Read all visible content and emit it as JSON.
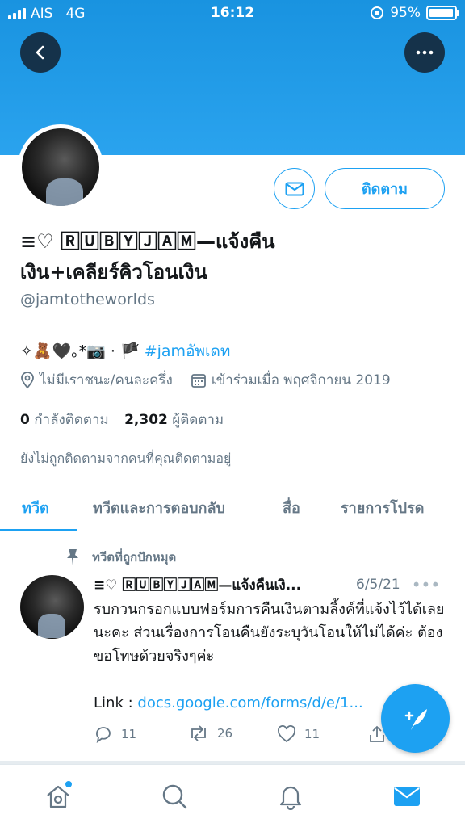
{
  "status_bar": {
    "carrier": "AIS",
    "network": "4G",
    "time": "16:12",
    "battery": "95%",
    "battery_level": 0.95
  },
  "profile": {
    "name": "≡♡ 🅁🅄🄱🅈🄹🄰🄼—แจ้งคืนเงิน+เคลียร์คิวโอนเงิน",
    "handle": "@jamtotheworlds",
    "bio_text": "✧🧸🖤｡*📷 · 🏴᷄ ",
    "bio_hashtag": "#jamอัพเดท",
    "location": "ไม่มีเราชนะ/คนละครึ่ง",
    "joined": "เข้าร่วมเมื่อ พฤศจิกายน 2019",
    "following_count": "0",
    "following_label": "กำลังติดตาม",
    "followers_count": "2,302",
    "followers_label": "ผู้ติดตาม",
    "not_followed_text": "ยังไม่ถูกติดตามจากคนที่คุณติดตามอยู่",
    "follow_label": "ติดตาม"
  },
  "tabs": [
    {
      "label": "ทวีต",
      "active": true
    },
    {
      "label": "ทวีตและการตอบกลับ",
      "active": false
    },
    {
      "label": "สื่อ",
      "active": false
    },
    {
      "label": "รายการโปรด",
      "active": false
    }
  ],
  "tweet": {
    "pinned_label": "ทวีตที่ถูกปักหมุด",
    "author": "≡♡ 🅁🅄🄱🅈🄹🄰🄼—แจ้งคืนเงิ...",
    "date": "6/5/21",
    "body": "รบกวนกรอกแบบฟอร์มการคืนเงินตามลิ้งค์ที่แจ้งไว้ได้เลยนะคะ ส่วนเรื่องการโอนคืนยังระบุวันโอนให้ไม่ได้ค่ะ ต้องขอโทษด้วยจริงๆค่ะ",
    "link_prefix": "Link :",
    "link_url": "docs.google.com/forms/d/e/1...",
    "replies": "11",
    "retweets": "26",
    "likes": "11"
  },
  "colors": {
    "accent": "#1da1f2",
    "banner": "#1e98e6",
    "muted": "#657786"
  },
  "icons": [
    "back-arrow-icon",
    "more-icon",
    "mail-icon",
    "location-icon",
    "calendar-icon",
    "pin-icon",
    "reply-icon",
    "retweet-icon",
    "like-icon",
    "share-icon",
    "compose-icon",
    "home-icon",
    "search-icon",
    "notifications-icon",
    "messages-icon"
  ]
}
